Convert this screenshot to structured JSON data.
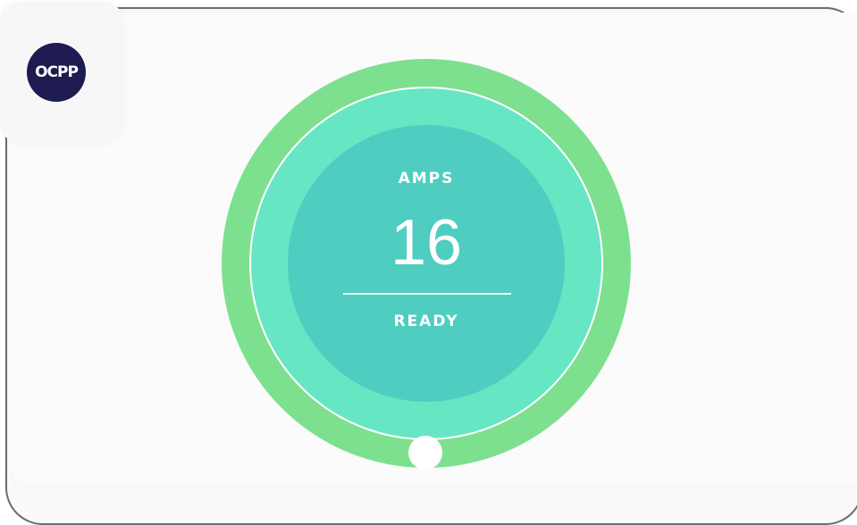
{
  "logo": {
    "text": "OCPP",
    "icon": "ocpp-logo"
  },
  "dial": {
    "label": "AMPS",
    "value": "16",
    "status": "READY"
  },
  "colors": {
    "outer_ring": "#7de08f",
    "middle_ring": "#67e6c4",
    "core": "#4ecdc0",
    "logo_bg": "#1d1b4f",
    "frame_border": "#6c6c6c"
  }
}
